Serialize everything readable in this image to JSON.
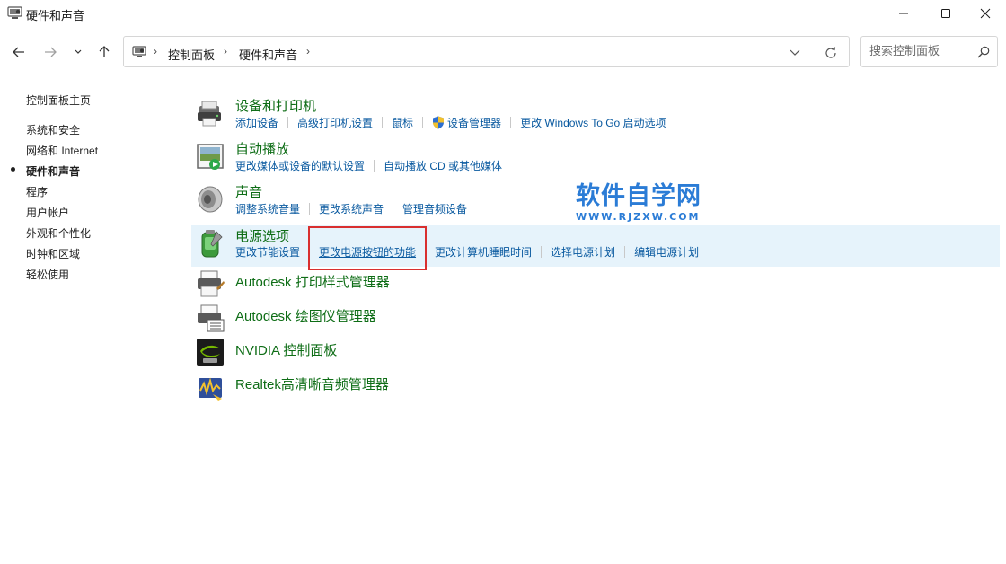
{
  "window": {
    "title": "硬件和声音"
  },
  "nav": {
    "breadcrumb": [
      "控制面板",
      "硬件和声音"
    ],
    "search_placeholder": "搜索控制面板"
  },
  "sidebar": {
    "items": [
      {
        "label": "控制面板主页",
        "active": false
      },
      {
        "label": "系统和安全",
        "active": false
      },
      {
        "label": "网络和 Internet",
        "active": false
      },
      {
        "label": "硬件和声音",
        "active": true
      },
      {
        "label": "程序",
        "active": false
      },
      {
        "label": "用户帐户",
        "active": false
      },
      {
        "label": "外观和个性化",
        "active": false
      },
      {
        "label": "时钟和区域",
        "active": false
      },
      {
        "label": "轻松使用",
        "active": false
      }
    ]
  },
  "categories": [
    {
      "title": "设备和打印机",
      "icon": "printer-device-icon",
      "links": [
        "添加设备",
        "高级打印机设置",
        "鼠标",
        "设备管理器",
        "更改 Windows To Go 启动选项"
      ]
    },
    {
      "title": "自动播放",
      "icon": "autoplay-icon",
      "links": [
        "更改媒体或设备的默认设置",
        "自动播放 CD 或其他媒体"
      ]
    },
    {
      "title": "声音",
      "icon": "speaker-icon",
      "links": [
        "调整系统音量",
        "更改系统声音",
        "管理音频设备"
      ]
    },
    {
      "title": "电源选项",
      "icon": "battery-icon",
      "highlighted": true,
      "links": [
        "更改节能设置",
        "更改电源按钮的功能",
        "更改计算机睡眠时间",
        "选择电源计划",
        "编辑电源计划"
      ]
    },
    {
      "title": "Autodesk 打印样式管理器",
      "icon": "print-style-icon",
      "links": []
    },
    {
      "title": "Autodesk 绘图仪管理器",
      "icon": "plotter-icon",
      "links": []
    },
    {
      "title": "NVIDIA 控制面板",
      "icon": "nvidia-icon",
      "links": []
    },
    {
      "title": "Realtek高清晰音频管理器",
      "icon": "realtek-audio-icon",
      "links": []
    }
  ],
  "watermark": {
    "line1": "软件自学网",
    "line2": "WWW.RJZXW.COM"
  },
  "colors": {
    "category_title": "#0e6d16",
    "link": "#0a5aa0",
    "highlight_row": "#e6f3fb",
    "red_box": "#d92f2f",
    "watermark": "#2b7cd6"
  }
}
